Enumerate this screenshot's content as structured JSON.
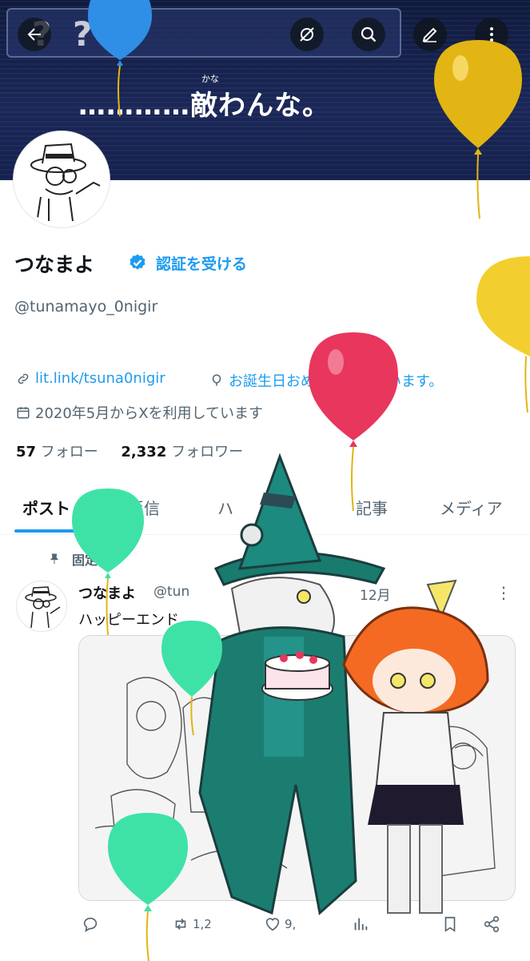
{
  "banner": {
    "qmarks": "? ? ?",
    "ruby": "かな",
    "text": "…………敵わんな。"
  },
  "header_buttons": [
    "back-icon",
    "mute-icon",
    "search-icon",
    "compose-icon",
    "more-icon"
  ],
  "profile": {
    "display_name": "つなまよ",
    "verify_label": "認証を受ける",
    "handle": "@tunamayo_0nigir",
    "link": "lit.link/tsuna0nigir",
    "birthday": "お誕生日おめでとうございます。",
    "joined": "2020年5月からXを利用しています",
    "following_count": "57",
    "following_label": "フォロー",
    "followers_count": "2,332",
    "followers_label": "フォロワー"
  },
  "tabs": [
    {
      "label": "ポスト",
      "active": true
    },
    {
      "label": "返信",
      "active": false
    },
    {
      "label": "ハ",
      "active": false
    },
    {
      "label": "記事",
      "active": false
    },
    {
      "label": "メディア",
      "active": false
    }
  ],
  "post": {
    "pinned_label": "固定",
    "name": "つなまよ",
    "handle": "@tun",
    "time": "12月",
    "text": "ハッピーエンド",
    "reposts": "1,2",
    "likes": "9,"
  },
  "colors": {
    "accent": "#1d9bf0",
    "text": "#0f1419",
    "muted": "#536471",
    "balloon_yellow": "#e2b514",
    "balloon_red": "#e8365d",
    "balloon_green": "#3fe2a6",
    "balloon_blue": "#2f8fe6"
  }
}
